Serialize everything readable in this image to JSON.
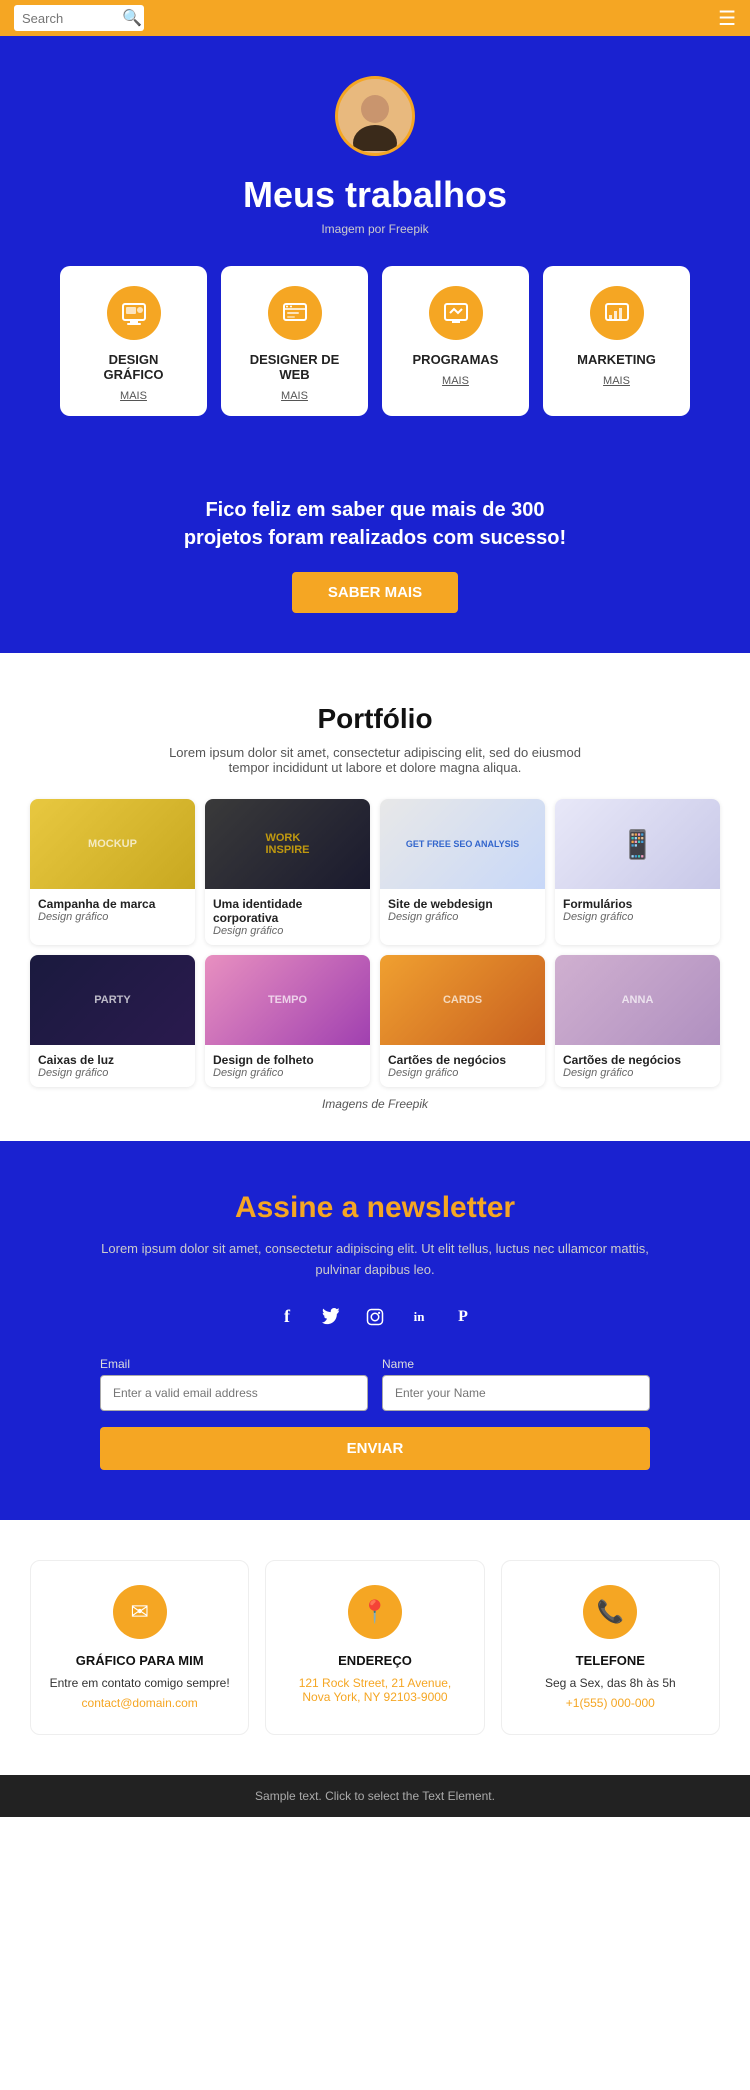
{
  "header": {
    "search_placeholder": "Search",
    "search_icon": "🔍",
    "hamburger_icon": "☰"
  },
  "hero": {
    "title": "Meus trabalhos",
    "image_credit": "Imagem por Freepik"
  },
  "services": {
    "cards": [
      {
        "id": "design-grafico",
        "title": "DESIGN\nGRÁFICO",
        "mais": "MAIS"
      },
      {
        "id": "designer-web",
        "title": "DESIGNER DE\nWEB",
        "mais": "MAIS"
      },
      {
        "id": "programas",
        "title": "PROGRAMAS",
        "mais": "MAIS"
      },
      {
        "id": "marketing",
        "title": "MARKETING",
        "mais": "MAIS"
      }
    ]
  },
  "cta": {
    "text": "Fico feliz em saber que mais de 300\nprojetos foram realizados com sucesso!",
    "button": "SABER MAIS"
  },
  "portfolio": {
    "title": "Portfólio",
    "description": "Lorem ipsum dolor sit amet, consectetur adipiscing elit, sed do eiusmod tempor incididunt ut labore et dolore magna aliqua.",
    "items": [
      {
        "id": "item1",
        "title": "Campanha de marca",
        "category": "Design gráfico",
        "thumb": "mockup"
      },
      {
        "id": "item2",
        "title": "Uma identidade corporativa",
        "category": "Design gráfico",
        "thumb": "work"
      },
      {
        "id": "item3",
        "title": "Site de webdesign",
        "category": "Design gráfico",
        "thumb": "seo"
      },
      {
        "id": "item4",
        "title": "Formulários",
        "category": "Design gráfico",
        "thumb": "phone"
      },
      {
        "id": "item5",
        "title": "Caixas de luz",
        "category": "Design gráfico",
        "thumb": "light"
      },
      {
        "id": "item6",
        "title": "Design de folheto",
        "category": "Design gráfico",
        "thumb": "flyer"
      },
      {
        "id": "item7",
        "title": "Cartões de negócios",
        "category": "Design gráfico",
        "thumb": "cards"
      },
      {
        "id": "item8",
        "title": "Cartões de negócios",
        "category": "Design gráfico",
        "thumb": "cards2"
      }
    ],
    "credit": "Imagens de Freepik"
  },
  "newsletter": {
    "title": "Assine a newsletter",
    "description": "Lorem ipsum dolor sit amet, consectetur adipiscing elit. Ut elit tellus, luctus nec ullamcor mattis, pulvinar dapibus leo.",
    "social": [
      {
        "id": "facebook",
        "icon": "f",
        "label": "Facebook"
      },
      {
        "id": "twitter",
        "icon": "🐦",
        "label": "Twitter"
      },
      {
        "id": "instagram",
        "icon": "📷",
        "label": "Instagram"
      },
      {
        "id": "linkedin",
        "icon": "in",
        "label": "LinkedIn"
      },
      {
        "id": "pinterest",
        "icon": "𝐏",
        "label": "Pinterest"
      }
    ],
    "email_label": "Email",
    "email_placeholder": "Enter a valid email address",
    "name_label": "Name",
    "name_placeholder": "Enter your Name",
    "button": "ENVIAR"
  },
  "contact": {
    "cards": [
      {
        "id": "grafico",
        "title": "GRÁFICO PARA MIM",
        "subtitle": "Entre em contato comigo sempre!",
        "link": "contact@domain.com",
        "icon": "✉"
      },
      {
        "id": "endereco",
        "title": "ENDEREÇO",
        "subtitle": "",
        "link": "121 Rock Street, 21 Avenue,\nNova York, NY 92103-9000",
        "icon": "📍"
      },
      {
        "id": "telefone",
        "title": "TELEFONE",
        "subtitle": "Seg a Sex, das 8h às 5h",
        "link": "+1(555) 000-000",
        "icon": "📞"
      }
    ]
  },
  "footer": {
    "text": "Sample text. Click to select the Text Element."
  }
}
